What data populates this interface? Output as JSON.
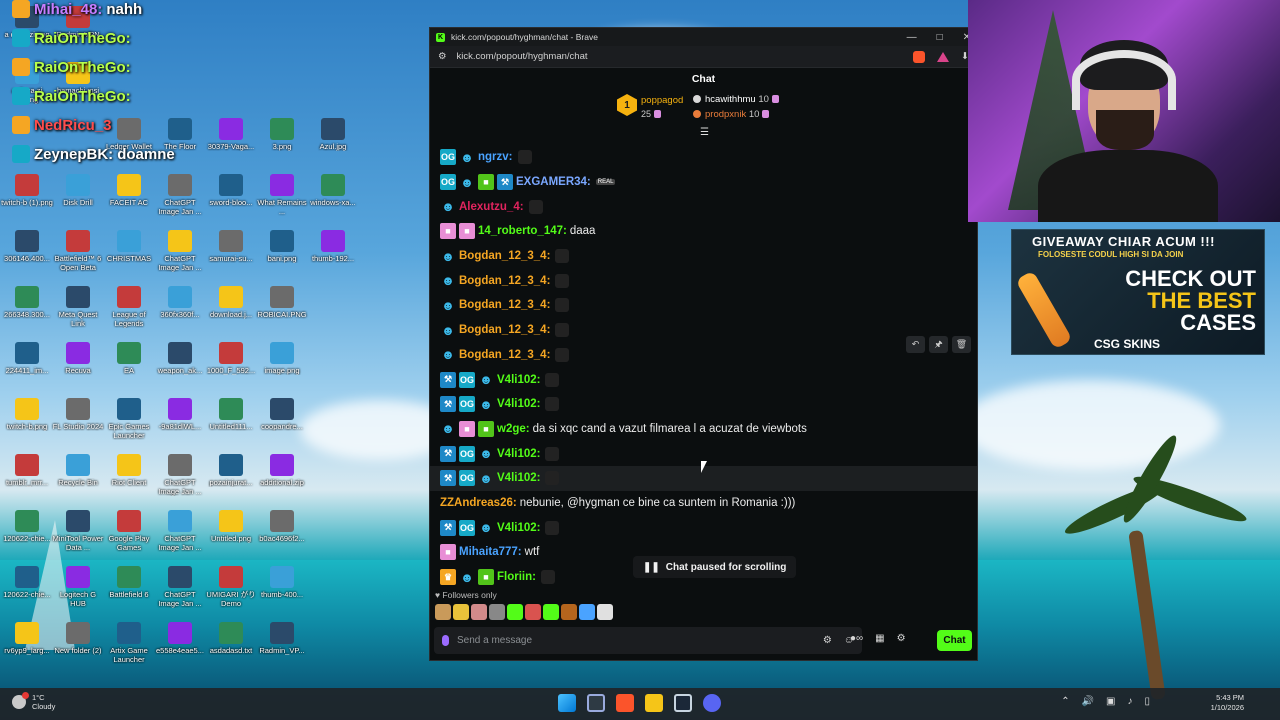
{
  "overlay_chat": [
    {
      "name": "Mihai_48:",
      "text": "nahh",
      "color": "#c77dff"
    },
    {
      "name": "RaiOnTheGo:",
      "text": "",
      "color": "#b7ff4a"
    },
    {
      "name": "RaiOnTheGo:",
      "text": "",
      "color": "#b7ff4a"
    },
    {
      "name": "RaiOnTheGo:",
      "text": "",
      "color": "#b7ff4a"
    },
    {
      "name": "NedRicu_3",
      "text": "",
      "color": "#ff4d4d"
    },
    {
      "name": "ZeynepBK:",
      "text": "doamne",
      "color": "#ffffff"
    }
  ],
  "desktop_icons": [
    {
      "label": "a doua zi.png",
      "col": 0,
      "row": 0
    },
    {
      "label": "Radmin VPN",
      "col": 1,
      "row": 0
    },
    {
      "label": "a doua zi 8k.png",
      "col": 0,
      "row": 1
    },
    {
      "label": "hamachi.msi",
      "col": 1,
      "row": 1
    },
    {
      "label": "Ledger Wallet",
      "col": 2,
      "row": 2
    },
    {
      "label": "The Floor",
      "col": 3,
      "row": 2
    },
    {
      "label": "30379-Vaga...",
      "col": 4,
      "row": 2
    },
    {
      "label": "3.png",
      "col": 5,
      "row": 2
    },
    {
      "label": "Azul.jpg",
      "col": 6,
      "row": 2
    },
    {
      "label": "twitch-b (1).png",
      "col": 0,
      "row": 3
    },
    {
      "label": "Disk Drill",
      "col": 1,
      "row": 3
    },
    {
      "label": "FACEIT AC",
      "col": 2,
      "row": 3
    },
    {
      "label": "ChatGPT Image Jan ...",
      "col": 3,
      "row": 3
    },
    {
      "label": "sword-bloo...",
      "col": 4,
      "row": 3
    },
    {
      "label": "What Remains ...",
      "col": 5,
      "row": 3
    },
    {
      "label": "windows-xa...",
      "col": 6,
      "row": 3
    },
    {
      "label": "306146.400...",
      "col": 0,
      "row": 4
    },
    {
      "label": "Battlefield™ 6 Open Beta",
      "col": 1,
      "row": 4
    },
    {
      "label": "CHRISTMAS",
      "col": 2,
      "row": 4
    },
    {
      "label": "ChatGPT Image Jan ...",
      "col": 3,
      "row": 4
    },
    {
      "label": "samurai-su...",
      "col": 4,
      "row": 4
    },
    {
      "label": "bani.png",
      "col": 5,
      "row": 4
    },
    {
      "label": "thumb-192...",
      "col": 6,
      "row": 4
    },
    {
      "label": "266348.300...",
      "col": 0,
      "row": 5
    },
    {
      "label": "Meta Quest Link",
      "col": 1,
      "row": 5
    },
    {
      "label": "League of Legends",
      "col": 2,
      "row": 5
    },
    {
      "label": "360fx360f...",
      "col": 3,
      "row": 5
    },
    {
      "label": "download.j...",
      "col": 4,
      "row": 5
    },
    {
      "label": "ROBICAI.PNG",
      "col": 5,
      "row": 5
    },
    {
      "label": "224411_im...",
      "col": 0,
      "row": 6
    },
    {
      "label": "Recuva",
      "col": 1,
      "row": 6
    },
    {
      "label": "EA",
      "col": 2,
      "row": 6
    },
    {
      "label": "weapon_ak...",
      "col": 3,
      "row": 6
    },
    {
      "label": "1000_F_592...",
      "col": 4,
      "row": 6
    },
    {
      "label": "image.png",
      "col": 5,
      "row": 6
    },
    {
      "label": "twitch-b.png",
      "col": 0,
      "row": 7
    },
    {
      "label": "FL Studio 2024",
      "col": 1,
      "row": 7
    },
    {
      "label": "Epic Games Launcher",
      "col": 2,
      "row": 7
    },
    {
      "label": "-9a81dlWL...",
      "col": 3,
      "row": 7
    },
    {
      "label": "Untitled111...",
      "col": 4,
      "row": 7
    },
    {
      "label": "coopandre...",
      "col": 5,
      "row": 7
    },
    {
      "label": "tumblr_mrr...",
      "col": 0,
      "row": 8
    },
    {
      "label": "Recycle Bin",
      "col": 1,
      "row": 8
    },
    {
      "label": "Riot Client",
      "col": 2,
      "row": 8
    },
    {
      "label": "ChatGPT Image Jan ...",
      "col": 3,
      "row": 8
    },
    {
      "label": "pozainjurat...",
      "col": 4,
      "row": 8
    },
    {
      "label": "additional.zip",
      "col": 5,
      "row": 8
    },
    {
      "label": "120622-chie...",
      "col": 0,
      "row": 9
    },
    {
      "label": "MiniTool Power Data ...",
      "col": 1,
      "row": 9
    },
    {
      "label": "Google Play Games",
      "col": 2,
      "row": 9
    },
    {
      "label": "ChatGPT Image Jan ...",
      "col": 3,
      "row": 9
    },
    {
      "label": "Untitled.png",
      "col": 4,
      "row": 9
    },
    {
      "label": "b0ac4696f2...",
      "col": 5,
      "row": 9
    },
    {
      "label": "120622-chie...",
      "col": 0,
      "row": 10
    },
    {
      "label": "Logitech G HUB",
      "col": 1,
      "row": 10
    },
    {
      "label": "Battlefield 6",
      "col": 2,
      "row": 10
    },
    {
      "label": "ChatGPT Image Jan ...",
      "col": 3,
      "row": 10
    },
    {
      "label": "UMIGARI がりDemo",
      "col": 4,
      "row": 10
    },
    {
      "label": "thumb-400...",
      "col": 5,
      "row": 10
    },
    {
      "label": "rv6yp9_larg...",
      "col": 0,
      "row": 11
    },
    {
      "label": "New folder (2)",
      "col": 1,
      "row": 11
    },
    {
      "label": "Artix Game Launcher",
      "col": 2,
      "row": 11
    },
    {
      "label": "e558e4eae5...",
      "col": 3,
      "row": 11
    },
    {
      "label": "asdadasd.txt",
      "col": 4,
      "row": 11
    },
    {
      "label": "Radmin_VP...",
      "col": 5,
      "row": 11
    }
  ],
  "browser": {
    "title": "kick.com/popout/hyghman/chat - Brave",
    "url": "kick.com/popout/hyghman/chat"
  },
  "chat": {
    "header": "Chat",
    "leaderboard": {
      "first": {
        "rank": "1",
        "name": "poppagod",
        "count": "25"
      },
      "second": {
        "name": "hcawithhmu",
        "count": "10"
      },
      "third": {
        "name": "prodpxnik",
        "count": "10"
      }
    },
    "messages": [
      {
        "user": "ngrzv:",
        "text": "",
        "color": "#4aa3ff",
        "badges": [
          "og",
          "ghost"
        ],
        "emote": true
      },
      {
        "user": "EXGAMER34:",
        "text": "",
        "color": "#7aa7ff",
        "badges": [
          "og",
          "ghost",
          "green",
          "blue"
        ],
        "emote": false,
        "real": "REAL"
      },
      {
        "user": "Alexutzu_4:",
        "text": "",
        "color": "#e0245e",
        "badges": [
          "ghost"
        ],
        "emote": true
      },
      {
        "user": "14_roberto_147:",
        "text": "daaa",
        "color": "#53fc18",
        "badges": [
          "pink",
          "pink"
        ],
        "emote": false
      },
      {
        "user": "Bogdan_12_3_4:",
        "text": "",
        "color": "#f5a623",
        "badges": [
          "ghost"
        ],
        "emote": true
      },
      {
        "user": "Bogdan_12_3_4:",
        "text": "",
        "color": "#f5a623",
        "badges": [
          "ghost"
        ],
        "emote": true
      },
      {
        "user": "Bogdan_12_3_4:",
        "text": "",
        "color": "#f5a623",
        "badges": [
          "ghost"
        ],
        "emote": true
      },
      {
        "user": "Bogdan_12_3_4:",
        "text": "",
        "color": "#f5a623",
        "badges": [
          "ghost"
        ],
        "emote": true
      },
      {
        "user": "Bogdan_12_3_4:",
        "text": "",
        "color": "#f5a623",
        "badges": [
          "ghost"
        ],
        "emote": true
      },
      {
        "user": "V4li102:",
        "text": "",
        "color": "#53fc18",
        "badges": [
          "blue",
          "og",
          "ghost"
        ],
        "emote": true
      },
      {
        "user": "V4li102:",
        "text": "",
        "color": "#53fc18",
        "badges": [
          "blue",
          "og",
          "ghost"
        ],
        "emote": true
      },
      {
        "user": "w2ge:",
        "text": "da si xqc cand a vazut filmarea l a acuzat de viewbots",
        "color": "#53fc18",
        "badges": [
          "ghost",
          "pink",
          "green"
        ],
        "emote": false
      },
      {
        "user": "V4li102:",
        "text": "",
        "color": "#53fc18",
        "badges": [
          "blue",
          "og",
          "ghost"
        ],
        "emote": true
      },
      {
        "user": "V4li102:",
        "text": "",
        "color": "#53fc18",
        "badges": [
          "blue",
          "og",
          "ghost"
        ],
        "emote": true,
        "hover": true
      },
      {
        "user": "ZZAndreas26:",
        "text": "nebunie, @hygman ce bine ca suntem in Romania :)))",
        "color": "#f5a623",
        "badges": [],
        "emote": false
      },
      {
        "user": "V4li102:",
        "text": "",
        "color": "#53fc18",
        "badges": [
          "blue",
          "og",
          "ghost"
        ],
        "emote": true
      },
      {
        "user": "Mihaita777:",
        "text": "wtf",
        "color": "#4aa3ff",
        "badges": [
          "pink"
        ],
        "emote": false
      },
      {
        "user": "Floriin:",
        "text": "",
        "color": "#53fc18",
        "badges": [
          "gold",
          "ghost",
          "green"
        ],
        "emote": true
      }
    ],
    "paused_label": "Chat paused for scrolling",
    "followers_only": "Followers only",
    "input_placeholder": "Send a message",
    "send_label": "Chat"
  },
  "ad": {
    "headline": "GIVEAWAY CHIAR ACUM !!!",
    "subline": "FOLOSESTE CODUL HIGH SI DA JOIN",
    "line1": "CHECK OUT",
    "line2": "THE BEST",
    "line3": "CASES",
    "brand": "CSG SKINS"
  },
  "taskbar": {
    "temp": "1°C",
    "weather": "Cloudy",
    "time": "5:43 PM",
    "date": "1/10/2026"
  },
  "colors": {
    "kick_green": "#53fc18",
    "window_bg": "#0b0e0f"
  }
}
